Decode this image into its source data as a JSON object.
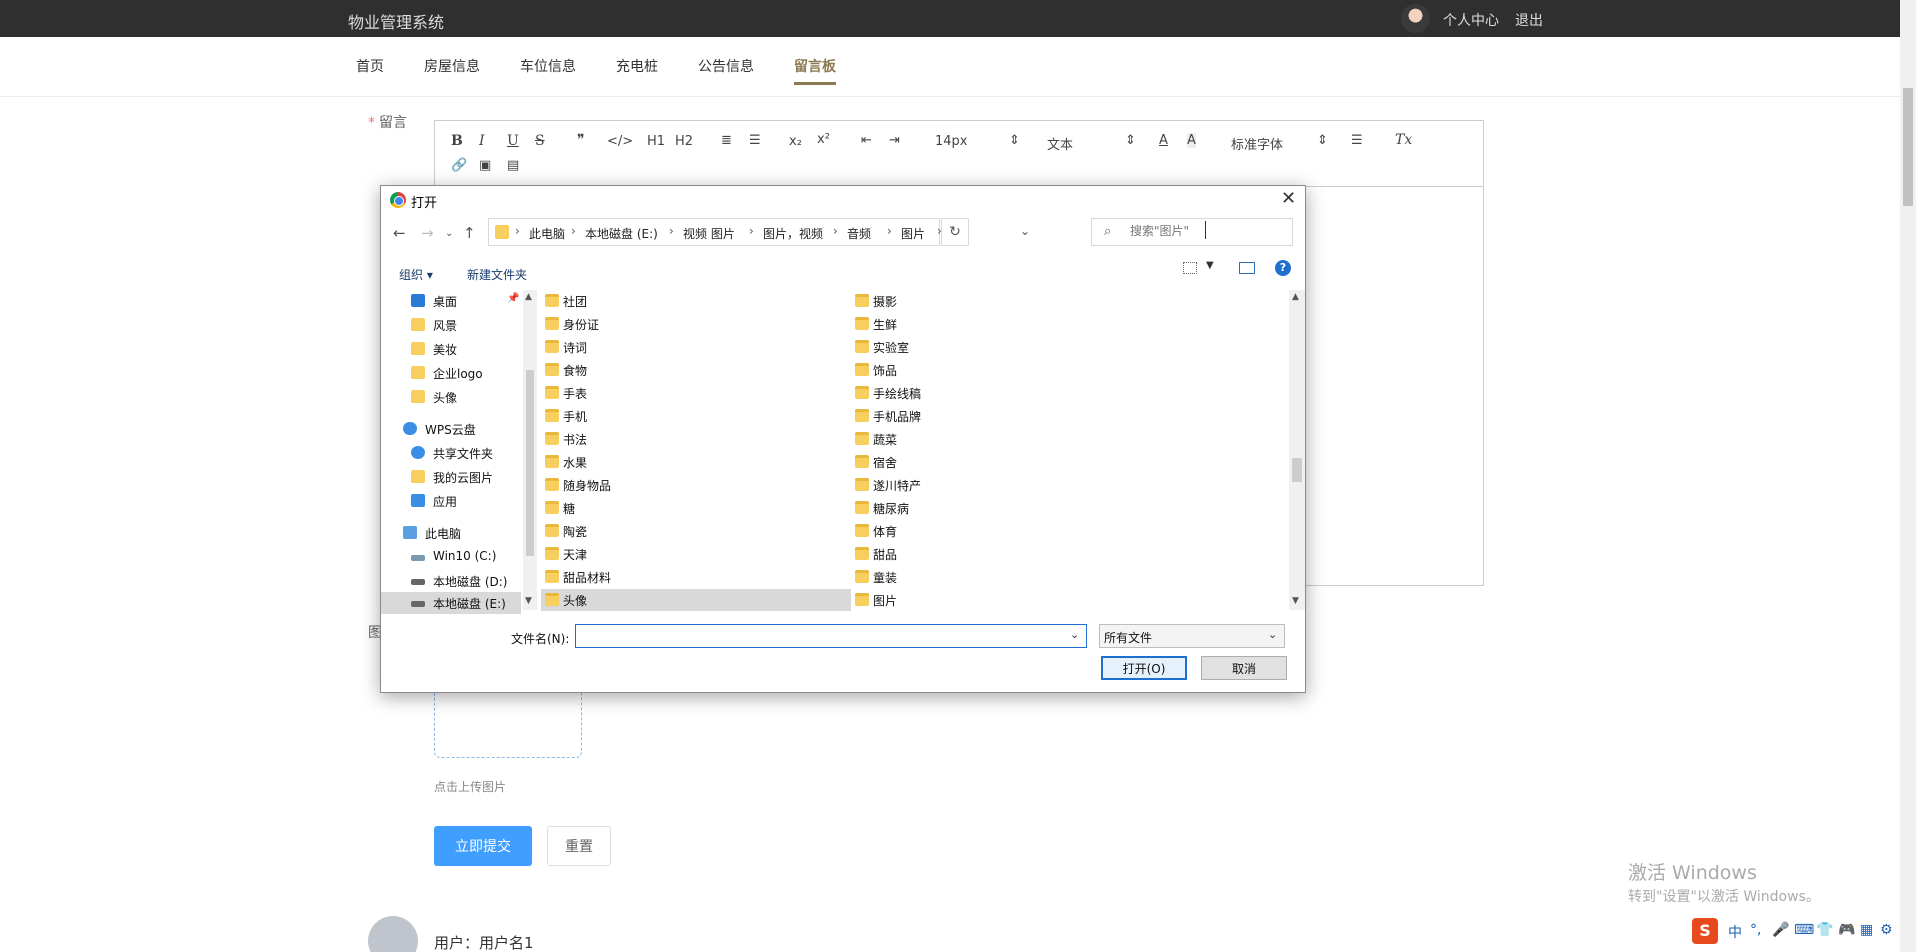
{
  "app": {
    "brand": "物业管理系统",
    "profile_link": "个人中心",
    "logout_link": "退出"
  },
  "nav": {
    "items": [
      "首页",
      "房屋信息",
      "车位信息",
      "充电桩",
      "公告信息",
      "留言板"
    ],
    "active": "留言板"
  },
  "form": {
    "message_label": "留言",
    "required_mark": "*",
    "image_label": "图",
    "upload_hint": "点击上传图片",
    "submit_label": "立即提交",
    "reset_label": "重置"
  },
  "editor": {
    "font_size": "14px",
    "block_type": "文本",
    "font_family": "标准字体",
    "tools": [
      "B",
      "I",
      "U",
      "S",
      "❞",
      "</>",
      "H1",
      "H2",
      "≣",
      "☰",
      "x₂",
      "x²",
      "⇤",
      "⇥",
      "A",
      "Tx"
    ]
  },
  "comment": {
    "user_text": "用户：用户名1"
  },
  "dialog": {
    "title": "打开",
    "breadcrumb": [
      "此电脑",
      "本地磁盘 (E:)",
      "视频 图片",
      "图片，视频",
      "音频",
      "图片"
    ],
    "search_placeholder": "搜索\"图片\"",
    "organize": "组织 ▾",
    "new_folder": "新建文件夹",
    "sidebar": [
      {
        "label": "桌面",
        "icon": "desktop-icon",
        "color": "#2b7bd6"
      },
      {
        "label": "风景",
        "icon": "folder-icon",
        "color": "#f7cf5e"
      },
      {
        "label": "美妆",
        "icon": "folder-icon",
        "color": "#f7cf5e"
      },
      {
        "label": "企业logo",
        "icon": "folder-icon",
        "color": "#f7cf5e"
      },
      {
        "label": "头像",
        "icon": "folder-icon",
        "color": "#f7cf5e"
      },
      {
        "label": "WPS云盘",
        "icon": "cloud-icon",
        "color": "#3a8ee6"
      },
      {
        "label": "共享文件夹",
        "icon": "share-icon",
        "color": "#3a8ee6"
      },
      {
        "label": "我的云图片",
        "icon": "folder-icon",
        "color": "#f7cf5e"
      },
      {
        "label": "应用",
        "icon": "apps-icon",
        "color": "#3a8ee6"
      },
      {
        "label": "此电脑",
        "icon": "computer-icon",
        "color": "#5aa0e0"
      },
      {
        "label": "Win10 (C:)",
        "icon": "drive-icon",
        "color": "#8aa"
      },
      {
        "label": "本地磁盘 (D:)",
        "icon": "drive-icon",
        "color": "#666"
      },
      {
        "label": "本地磁盘 (E:)",
        "icon": "drive-icon",
        "color": "#666"
      }
    ],
    "files_left": [
      "社团",
      "身份证",
      "诗词",
      "食物",
      "手表",
      "手机",
      "书法",
      "水果",
      "随身物品",
      "糖",
      "陶瓷",
      "天津",
      "甜品材料",
      "头像"
    ],
    "files_right": [
      "摄影",
      "生鲜",
      "实验室",
      "饰品",
      "手绘线稿",
      "手机品牌",
      "蔬菜",
      "宿舍",
      "遂川特产",
      "糖尿病",
      "体育",
      "甜品",
      "童装",
      "图片"
    ],
    "selected_file": "头像",
    "filename_label": "文件名(N):",
    "filename_value": "",
    "filetype": "所有文件",
    "open_label": "打开(O)",
    "cancel_label": "取消"
  },
  "watermark": {
    "line1": "激活 Windows",
    "line2": "转到\"设置\"以激活 Windows。"
  },
  "ime": {
    "logo": "S",
    "lang": "中"
  }
}
